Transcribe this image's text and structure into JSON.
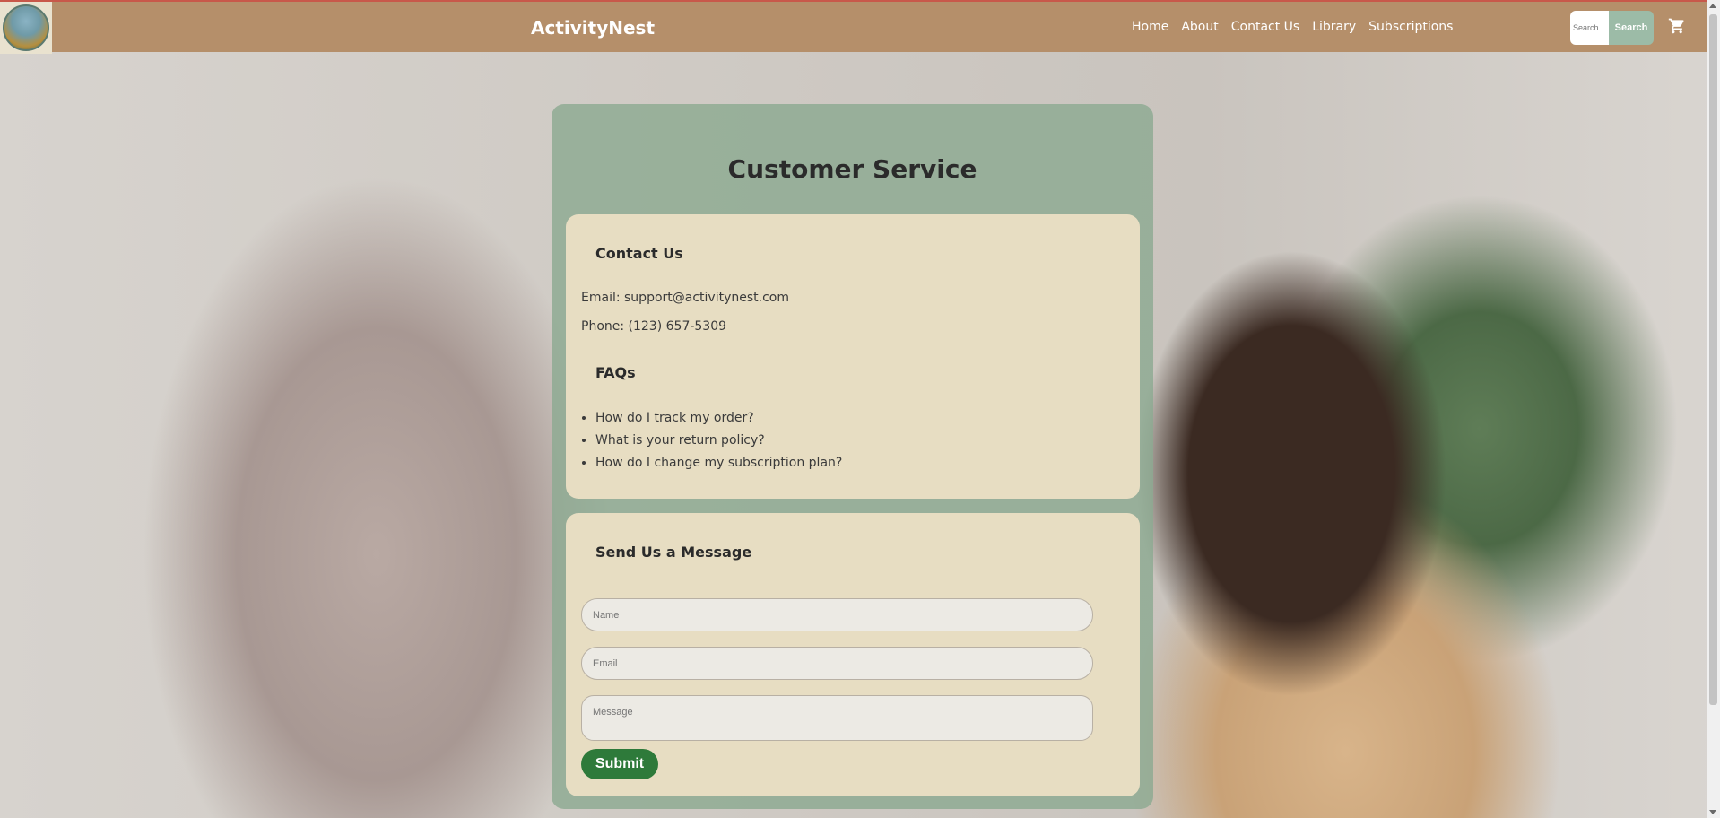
{
  "header": {
    "brand": "ActivityNest",
    "nav": [
      "Home",
      "About",
      "Contact Us",
      "Library",
      "Subscriptions"
    ],
    "search_placeholder": "Search",
    "search_button": "Search",
    "cart_icon": "cart-icon"
  },
  "main": {
    "title": "Customer Service",
    "contact": {
      "heading": "Contact Us",
      "email": "Email: support@activitynest.com",
      "phone": "Phone: (123) 657-5309"
    },
    "faqs": {
      "heading": "FAQs",
      "items": [
        "How do I track my order?",
        "What is your return policy?",
        "How do I change my subscription plan?"
      ]
    },
    "form": {
      "heading": "Send Us a Message",
      "name_placeholder": "Name",
      "email_placeholder": "Email",
      "message_placeholder": "Message",
      "submit_label": "Submit"
    }
  },
  "colors": {
    "header_bg": "#b58f6a",
    "panel_bg": "#8caa91",
    "card_bg": "#f0e2c6",
    "submit_bg": "#2e7a3a",
    "search_button_bg": "#9cbba7"
  }
}
